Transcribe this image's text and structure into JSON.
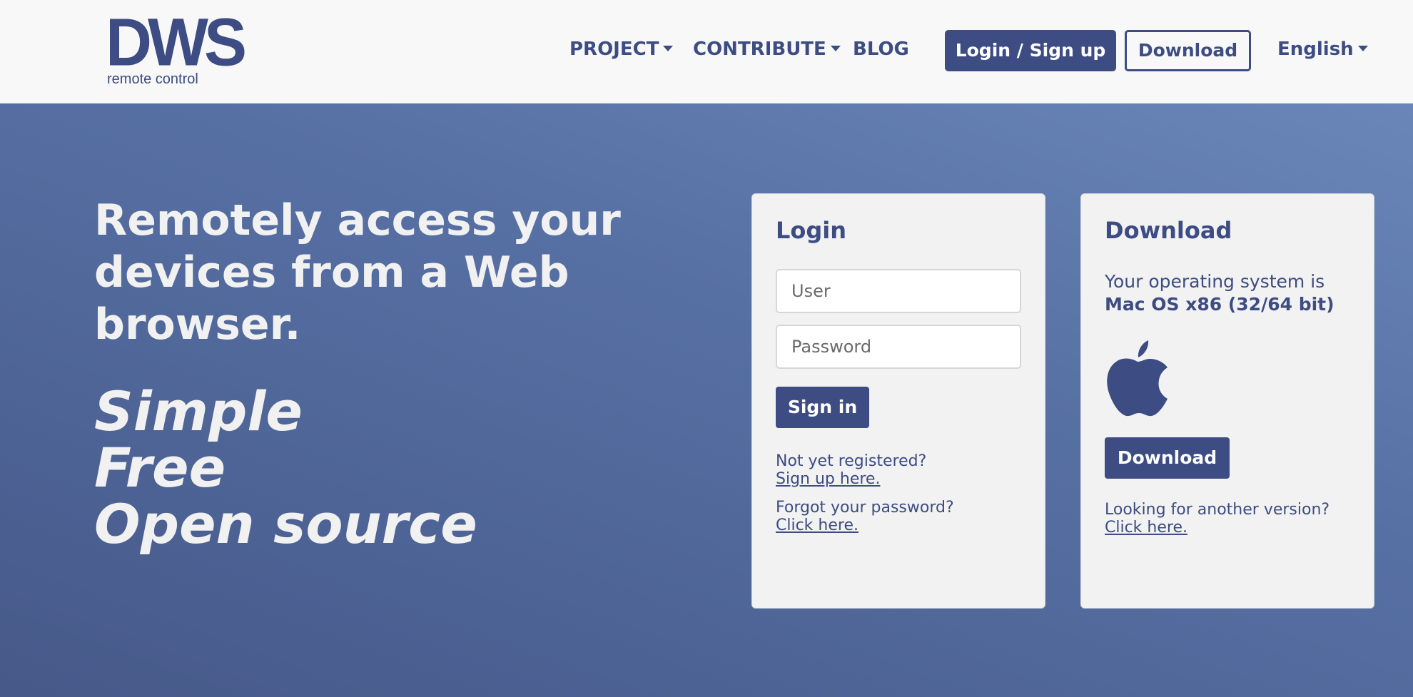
{
  "logo": {
    "mark": "DWS",
    "subtitle": "remote control"
  },
  "nav": {
    "project": "PROJECT",
    "contribute": "CONTRIBUTE",
    "blog": "BLOG",
    "login_signup": "Login / Sign up",
    "download": "Download",
    "language": "English"
  },
  "hero": {
    "headline": "Remotely access your devices from a Web browser.",
    "taglines": [
      "Simple",
      "Free",
      "Open source"
    ]
  },
  "login_card": {
    "title": "Login",
    "user_placeholder": "User",
    "password_placeholder": "Password",
    "sign_in": "Sign in",
    "not_registered": "Not yet registered?",
    "sign_up_link": "Sign up here.",
    "forgot_password": "Forgot your password?",
    "forgot_link": "Click here."
  },
  "download_card": {
    "title": "Download",
    "os_intro": "Your operating system is",
    "os_name": "Mac OS x86 (32/64 bit)",
    "os_icon": "apple-icon",
    "download_button": "Download",
    "other_version": "Looking for another version?",
    "other_link": "Click here."
  },
  "colors": {
    "primary": "#3d4c82",
    "topbar_bg": "#f8f8f8",
    "hero_gradient_light": "#6a86b8",
    "hero_gradient_dark": "#465989",
    "card_bg": "#f2f2f2",
    "hero_text": "#f1f1f1"
  }
}
